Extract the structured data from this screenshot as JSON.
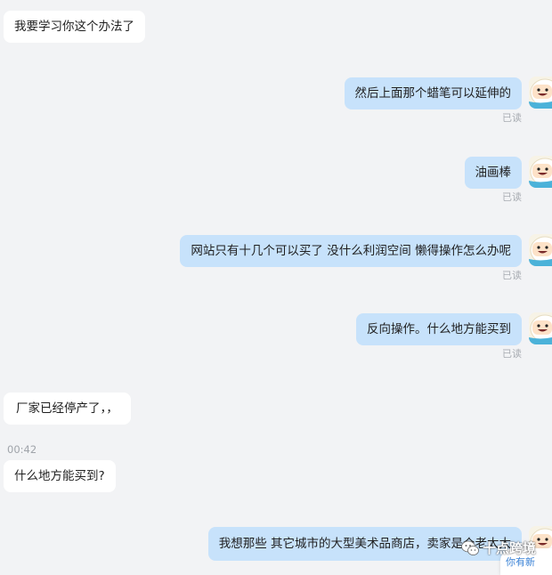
{
  "messages": [
    {
      "side": "in",
      "text": "我要学习你这个办法了"
    },
    {
      "side": "out",
      "text": "然后上面那个蜡笔可以延伸的",
      "status": "已读"
    },
    {
      "side": "out",
      "text": "油画棒",
      "status": "已读"
    },
    {
      "side": "out",
      "text": "网站只有十几个可以买了 没什么利润空间 懒得操作怎么办呢",
      "status": "已读"
    },
    {
      "side": "out",
      "text": "反向操作。什么地方能买到",
      "status": "已读"
    },
    {
      "side": "in",
      "text": "厂家已经停产了，，"
    },
    {
      "side": "in",
      "text": "什么地方能买到?"
    },
    {
      "side": "out",
      "text": "我想那些 其它城市的大型美术品商店，卖家是个老太太"
    }
  ],
  "timestamp": "00:42",
  "watermark": "十点跨境",
  "new_message_tip": "你有新",
  "colors": {
    "background": "#f2f3f5",
    "incoming_bubble": "#ffffff",
    "outgoing_bubble": "#c7e2fb",
    "read_status": "#a9adb3"
  },
  "icons": {
    "avatar": "cartoon-avatar-icon",
    "watermark": "wechat-logo-icon"
  }
}
